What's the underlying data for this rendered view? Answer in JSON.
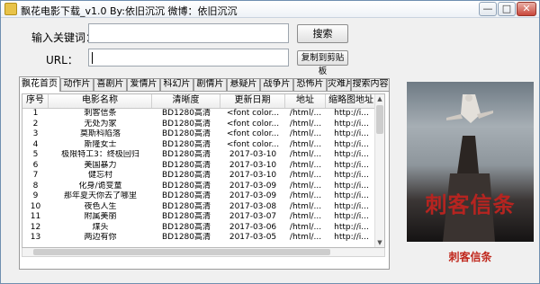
{
  "app": {
    "title": "飘花电影下载_v1.0  By:依旧沉沉  微博：依旧沉沉",
    "controls": {
      "minimize": "—",
      "maximize": "□",
      "close": "✕"
    }
  },
  "search": {
    "keyword_label": "输入关键词：",
    "keyword_value": "",
    "search_button": "搜索",
    "url_label": "URL：",
    "url_value": "",
    "copy_button": "复制到剪贴板"
  },
  "tabs": [
    "飘花首页",
    "动作片",
    "喜剧片",
    "爱情片",
    "科幻片",
    "剧情片",
    "悬疑片",
    "战争片",
    "恐怖片",
    "灾难片",
    "搜索内容"
  ],
  "active_tab": 0,
  "table": {
    "columns": [
      "序号",
      "电影名称",
      "清晰度",
      "更新日期",
      "地址",
      "缩略图地址"
    ],
    "rows": [
      [
        "1",
        "刺客信条",
        "BD1280高清",
        "<font color...",
        "/html/...",
        "http://i..."
      ],
      [
        "2",
        "无处为家",
        "BD1280高清",
        "<font color...",
        "/html/...",
        "http://i..."
      ],
      [
        "3",
        "莫斯科陷落",
        "BD1280高清",
        "<font color...",
        "/html/...",
        "http://i..."
      ],
      [
        "4",
        "斯隆女士",
        "BD1280高清",
        "<font color...",
        "/html/...",
        "http://i..."
      ],
      [
        "5",
        "极限特工3：终极回归",
        "BD1280高清",
        "2017-03-10",
        "/html/...",
        "http://i..."
      ],
      [
        "6",
        "美国暴力",
        "BD1280高清",
        "2017-03-10",
        "/html/...",
        "http://i..."
      ],
      [
        "7",
        "健忘村",
        "BD1280高清",
        "2017-03-10",
        "/html/...",
        "http://i..."
      ],
      [
        "8",
        "化身/诡变童",
        "BD1280高清",
        "2017-03-09",
        "/html/...",
        "http://i..."
      ],
      [
        "9",
        "那年夏天你去了哪里",
        "BD1280高清",
        "2017-03-09",
        "/html/...",
        "http://i..."
      ],
      [
        "10",
        "夜色人生",
        "BD1280高清",
        "2017-03-08",
        "/html/...",
        "http://i..."
      ],
      [
        "11",
        "附属美丽",
        "BD1280高清",
        "2017-03-07",
        "/html/...",
        "http://i..."
      ],
      [
        "12",
        "煤头",
        "BD1280高清",
        "2017-03-06",
        "/html/...",
        "http://i..."
      ],
      [
        "13",
        "两边有你",
        "BD1280高清",
        "2017-03-05",
        "/html/...",
        "http://i..."
      ]
    ]
  },
  "poster": {
    "title": "刺客信条",
    "subtitle": "",
    "caption": "刺客信条"
  },
  "colors": {
    "caption": "#c0281d",
    "poster_title": "#b62420"
  }
}
